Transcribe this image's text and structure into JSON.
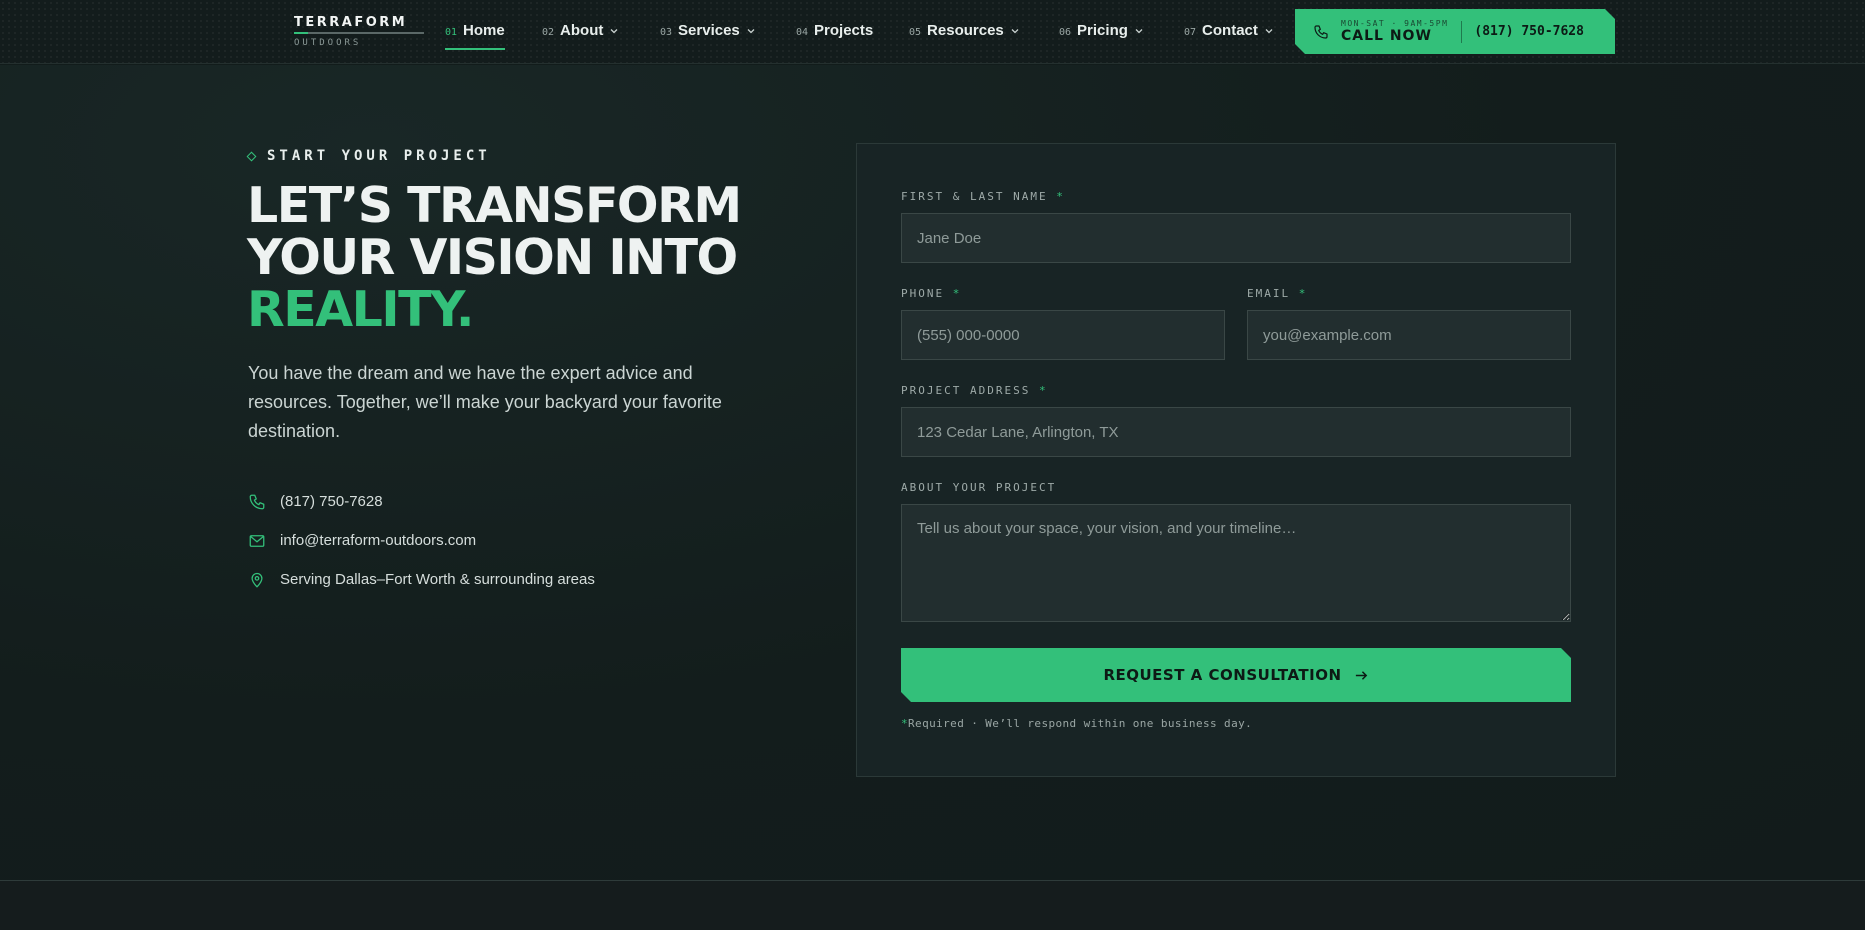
{
  "brand": {
    "name_top": "TERRAFORM",
    "name_bottom": "OUTDOORS"
  },
  "nav": {
    "items": [
      {
        "num": "01",
        "label": "Home",
        "active": true,
        "has_dropdown": false
      },
      {
        "num": "02",
        "label": "About",
        "active": false,
        "has_dropdown": true
      },
      {
        "num": "03",
        "label": "Services",
        "active": false,
        "has_dropdown": true
      },
      {
        "num": "04",
        "label": "Projects",
        "active": false,
        "has_dropdown": false
      },
      {
        "num": "05",
        "label": "Resources",
        "active": false,
        "has_dropdown": true
      },
      {
        "num": "06",
        "label": "Pricing",
        "active": false,
        "has_dropdown": true
      },
      {
        "num": "07",
        "label": "Contact",
        "active": false,
        "has_dropdown": true
      }
    ],
    "cta": {
      "hours": "MON-SAT · 9AM-5PM",
      "label": "CALL NOW",
      "phone": "(817) 750-7628",
      "icon": "phone-icon"
    }
  },
  "hero": {
    "eyebrow": "START YOUR PROJECT",
    "headline_line1": "LET’S TRANSFORM",
    "headline_line2": "YOUR VISION INTO",
    "headline_accent": "REALITY.",
    "lede": "You have the dream and we have the expert advice and resources. Together, we’ll make your backyard your favorite destination.",
    "contacts": [
      {
        "icon": "phone-icon",
        "text": "(817) 750-7628"
      },
      {
        "icon": "mail-icon",
        "text": "info@terraform-outdoors.com"
      },
      {
        "icon": "location-pin-icon",
        "text": "Serving Dallas–Fort Worth & surrounding areas"
      }
    ]
  },
  "form": {
    "name": {
      "label": "FIRST & LAST NAME",
      "required_mark": "*",
      "placeholder": "Jane Doe",
      "value": ""
    },
    "phone": {
      "label": "PHONE",
      "required_mark": "*",
      "placeholder": "(555) 000-0000",
      "value": ""
    },
    "email": {
      "label": "EMAIL",
      "required_mark": "*",
      "placeholder": "you@example.com",
      "value": ""
    },
    "address": {
      "label": "PROJECT ADDRESS",
      "required_mark": "*",
      "placeholder": "123 Cedar Lane, Arlington, TX",
      "value": ""
    },
    "about": {
      "label": "ABOUT YOUR PROJECT",
      "placeholder": "Tell us about your space, your vision, and your timeline…",
      "value": ""
    },
    "submit_label": "REQUEST A CONSULTATION",
    "note_mark": "*",
    "note": "Required · We’ll respond within one business day."
  },
  "colors": {
    "accent": "#33c07a",
    "background": "#121c1b",
    "card": "#182425"
  }
}
